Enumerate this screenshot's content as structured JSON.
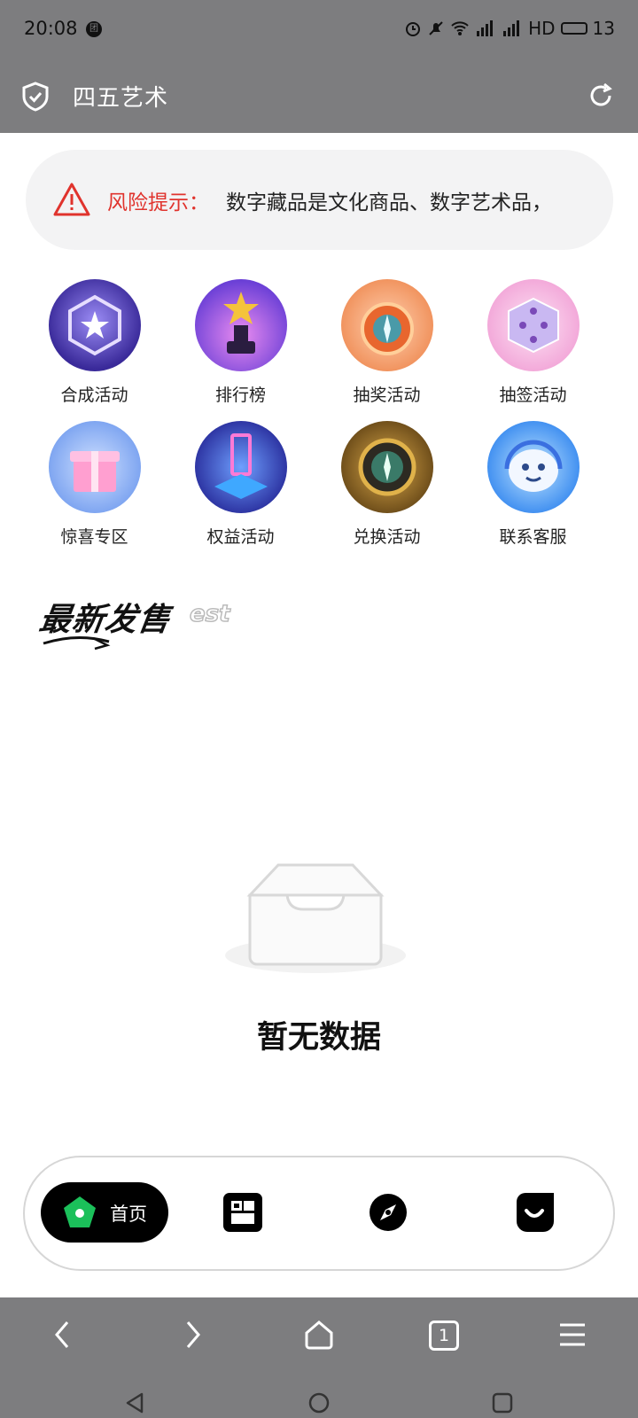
{
  "status_bar": {
    "time": "20:08",
    "badge": "团",
    "network": "HD",
    "battery": "13"
  },
  "title_bar": {
    "title": "四五艺术",
    "icons": [
      "shield-check-icon",
      "reload-icon"
    ]
  },
  "risk_notice": {
    "label": "风险提示：",
    "text": "数字藏品是文化商品、数字艺术品，",
    "color": "#e0332d"
  },
  "feature_grid": [
    {
      "label": "合成活动",
      "icon": "hexagon-star-icon",
      "color": "#3a2a9a"
    },
    {
      "label": "排行榜",
      "icon": "trophy-star-icon",
      "color": "#8a4ce0"
    },
    {
      "label": "抽奖活动",
      "icon": "compass-orb-icon",
      "color": "#f0905a"
    },
    {
      "label": "抽签活动",
      "icon": "dice-icon",
      "color": "#f2a6d8"
    },
    {
      "label": "惊喜专区",
      "icon": "gift-box-icon",
      "color": "#7aa2f0"
    },
    {
      "label": "权益活动",
      "icon": "portal-icon",
      "color": "#3a4ad8"
    },
    {
      "label": "兑换活动",
      "icon": "compass-icon",
      "color": "#8a6420"
    },
    {
      "label": "联系客服",
      "icon": "support-bot-icon",
      "color": "#3b8cf0"
    }
  ],
  "latest_section": {
    "title": "最新发售",
    "title_en": "est"
  },
  "empty_state": {
    "text": "暂无数据"
  },
  "tab_bar": {
    "home_label": "首页",
    "accent": "#1bc05a"
  },
  "browser_toolbar": {
    "tab_count": "1"
  }
}
